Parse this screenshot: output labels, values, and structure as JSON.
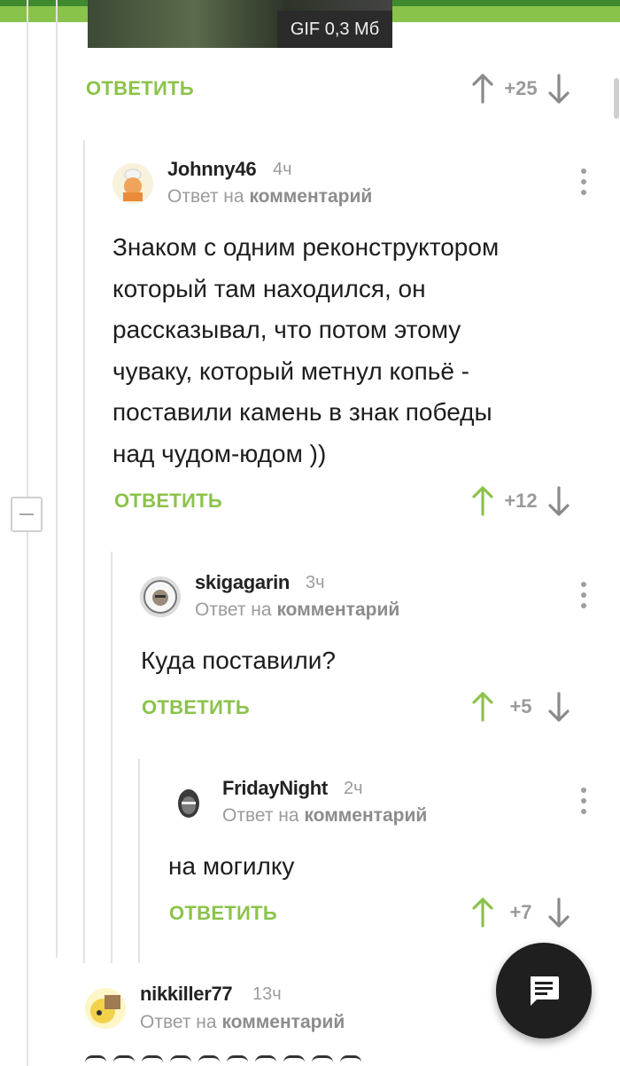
{
  "gif": {
    "badge": "GIF 0,3 Мб"
  },
  "labels": {
    "reply": "ОТВЕТИТЬ",
    "reply_to": "Ответ на",
    "comment_word": "комментарий"
  },
  "comments": [
    {
      "score": "+25",
      "voted_up": false
    },
    {
      "username": "Johnny46",
      "time": "4ч",
      "text": [
        "Знаком с одним реконструктором",
        "который там находился, он",
        "рассказывал, что потом этому",
        "чуваку, который метнул копьё -",
        "поставили камень в знак победы",
        "над чудом-юдом ))"
      ],
      "score": "+12",
      "voted_up": true
    },
    {
      "username": "skigagarin",
      "time": "3ч",
      "text": [
        "Куда поставили?"
      ],
      "score": "+5",
      "voted_up": true
    },
    {
      "username": "FridayNight",
      "time": "2ч",
      "text": [
        "на могилку"
      ],
      "score": "+7",
      "voted_up": true
    },
    {
      "username": "nikkiller77",
      "time": "13ч"
    }
  ],
  "colors": {
    "accent": "#8bc34a",
    "arrow_neutral": "#8a8a8a",
    "header_dark": "#3f8a2f"
  },
  "icons": [
    "arrow-up-icon",
    "arrow-down-icon",
    "more-vert-icon",
    "chat-icon",
    "collapse-icon"
  ]
}
